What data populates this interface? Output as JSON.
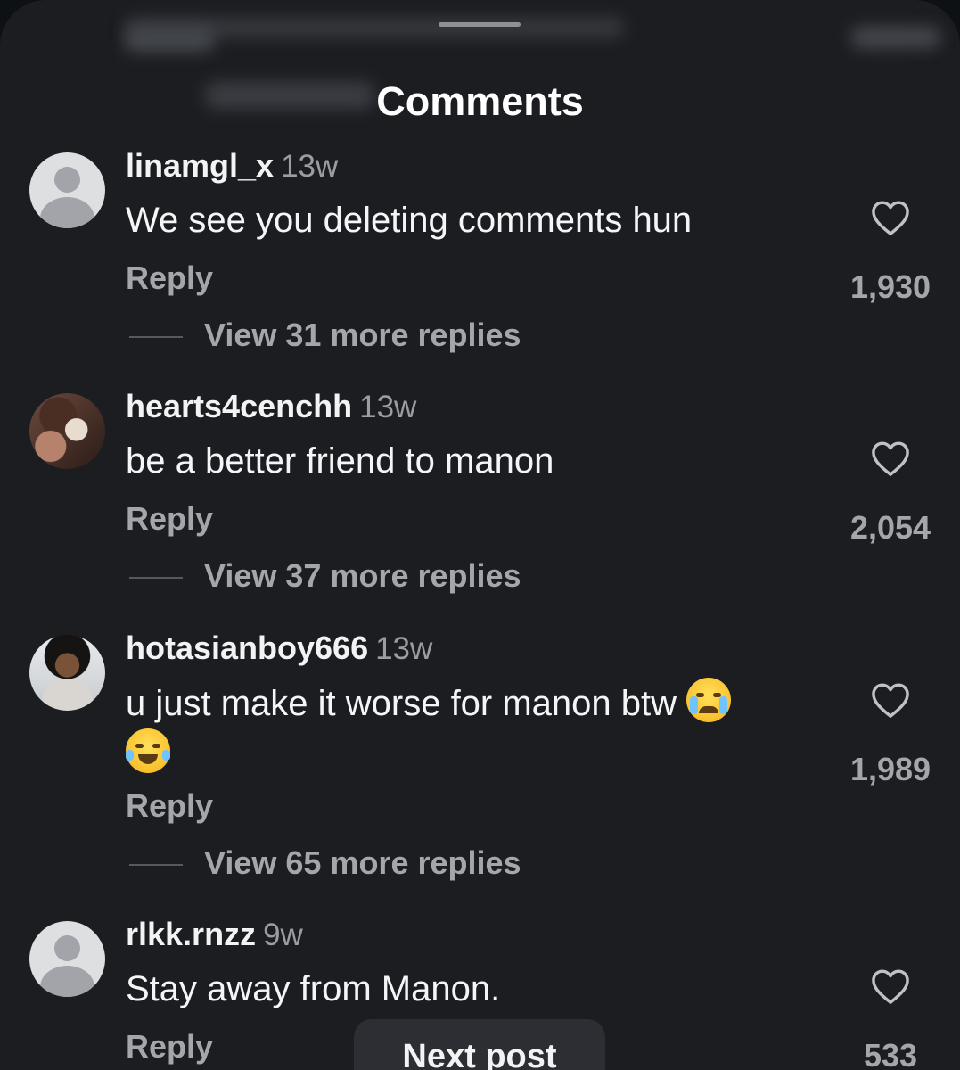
{
  "sheet": {
    "title": "Comments"
  },
  "comments": [
    {
      "username": "linamgl_x",
      "time": "13w",
      "text": "We see you deleting comments hun",
      "reply_label": "Reply",
      "likes": "1,930",
      "view_replies": "View 31 more replies",
      "avatar": "default-avatar-icon"
    },
    {
      "username": "hearts4cenchh",
      "time": "13w",
      "text": "be a better friend to manon",
      "reply_label": "Reply",
      "likes": "2,054",
      "view_replies": "View 37 more replies",
      "avatar": "photo"
    },
    {
      "username": "hotasianboy666",
      "time": "13w",
      "text": "u just make it worse for manon btw",
      "emojis": [
        "loudly-crying-face-emoji",
        "face-with-tears-of-joy-emoji"
      ],
      "reply_label": "Reply",
      "likes": "1,989",
      "view_replies": "View 65 more replies",
      "avatar": "photo"
    },
    {
      "username": "rlkk.rnzz",
      "time": "9w",
      "text": "Stay away from Manon.",
      "reply_label": "Reply",
      "likes": "533",
      "avatar": "default-avatar-icon"
    }
  ],
  "next_post": {
    "label": "Next post"
  },
  "colors": {
    "sheet_bg": "#1b1d21",
    "primary_text": "#f2f3f5",
    "secondary_text": "#a4a6ac"
  }
}
